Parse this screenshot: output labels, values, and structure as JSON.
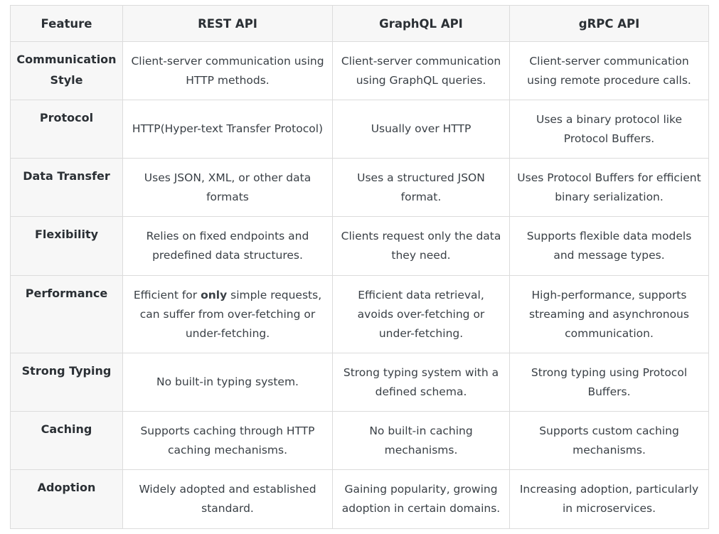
{
  "table": {
    "headers": [
      "Feature",
      "REST API",
      "GraphQL API",
      "gRPC API"
    ],
    "rows": [
      {
        "feature": "Communication Style",
        "rest": "Client-server communication using HTTP methods.",
        "graphql": "Client-server communication using GraphQL queries.",
        "grpc": "Client-server communication using remote procedure calls."
      },
      {
        "feature": "Protocol",
        "rest": "HTTP(Hyper-text Transfer Protocol)",
        "graphql": "Usually over HTTP",
        "grpc": "Uses a binary protocol like Protocol Buffers."
      },
      {
        "feature": "Data Transfer",
        "rest": "Uses JSON, XML, or other data formats",
        "graphql": "Uses a structured JSON format.",
        "grpc": "Uses Protocol Buffers for efficient binary serialization."
      },
      {
        "feature": "Flexibility",
        "rest": "Relies on fixed endpoints and predefined data structures.",
        "graphql": "Clients request only the data they need.",
        "grpc": "Supports flexible data models and message types."
      },
      {
        "feature": "Performance",
        "rest_pre": "Efficient for ",
        "rest_bold": "only",
        "rest_post": " simple requests, can suffer from over-fetching or under-fetching.",
        "graphql": "Efficient data retrieval, avoids over-fetching or under-fetching.",
        "grpc": "High-performance, supports streaming and asynchronous communication."
      },
      {
        "feature": "Strong Typing",
        "rest": "No built-in typing system.",
        "graphql": "Strong typing system with a defined schema.",
        "grpc": "Strong typing using Protocol Buffers."
      },
      {
        "feature": "Caching",
        "rest": "Supports caching through HTTP caching mechanisms.",
        "graphql": "No built-in caching mechanisms.",
        "grpc": "Supports custom caching mechanisms."
      },
      {
        "feature": "Adoption",
        "rest": "Widely adopted and established standard.",
        "graphql": "Gaining popularity, growing adoption in certain domains.",
        "grpc": "Increasing adoption, particularly in microservices."
      }
    ]
  }
}
